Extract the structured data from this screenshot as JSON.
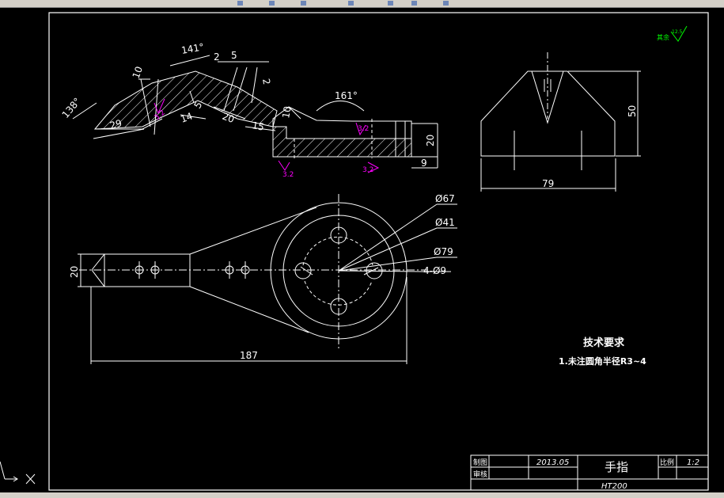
{
  "dimensions": {
    "angle_138": "138°",
    "angle_141": "141°",
    "angle_161": "161°",
    "len_10": "10",
    "len_5a": "5",
    "len_2a": "2",
    "len_2b": "2",
    "len_29": "29",
    "len_14": "14",
    "len_5b": "5",
    "len_20": "20",
    "len_15": "15",
    "len_10b": "10",
    "len_20v": "20",
    "len_9": "9",
    "dim_50": "50",
    "dim_79": "79",
    "dia_67": "Ø67",
    "dia_41": "Ø41",
    "dia_79": "Ø79",
    "holes_4_9": "4-Ø9",
    "len_20_plan": "20",
    "len_187": "187"
  },
  "roughness": {
    "r1": "3.2",
    "r2": "3.2",
    "r3": "3.2",
    "r4": "3.2",
    "r5": "3.2",
    "corner_label": "其余",
    "corner_value": "12.5"
  },
  "notes": {
    "heading": "技术要求",
    "item1": "1.未注圆角半径R3~4"
  },
  "title_block": {
    "drawn_label": "制图",
    "checked_label": "审核",
    "date": "2013.05",
    "part_name": "手指",
    "material": "HT200",
    "scale_label": "比例",
    "scale_value": "1:2"
  },
  "colors": {
    "background": "#000000",
    "lines": "#ffffff",
    "roughness": "#ff00ff",
    "corner_symbol": "#00ff00"
  }
}
